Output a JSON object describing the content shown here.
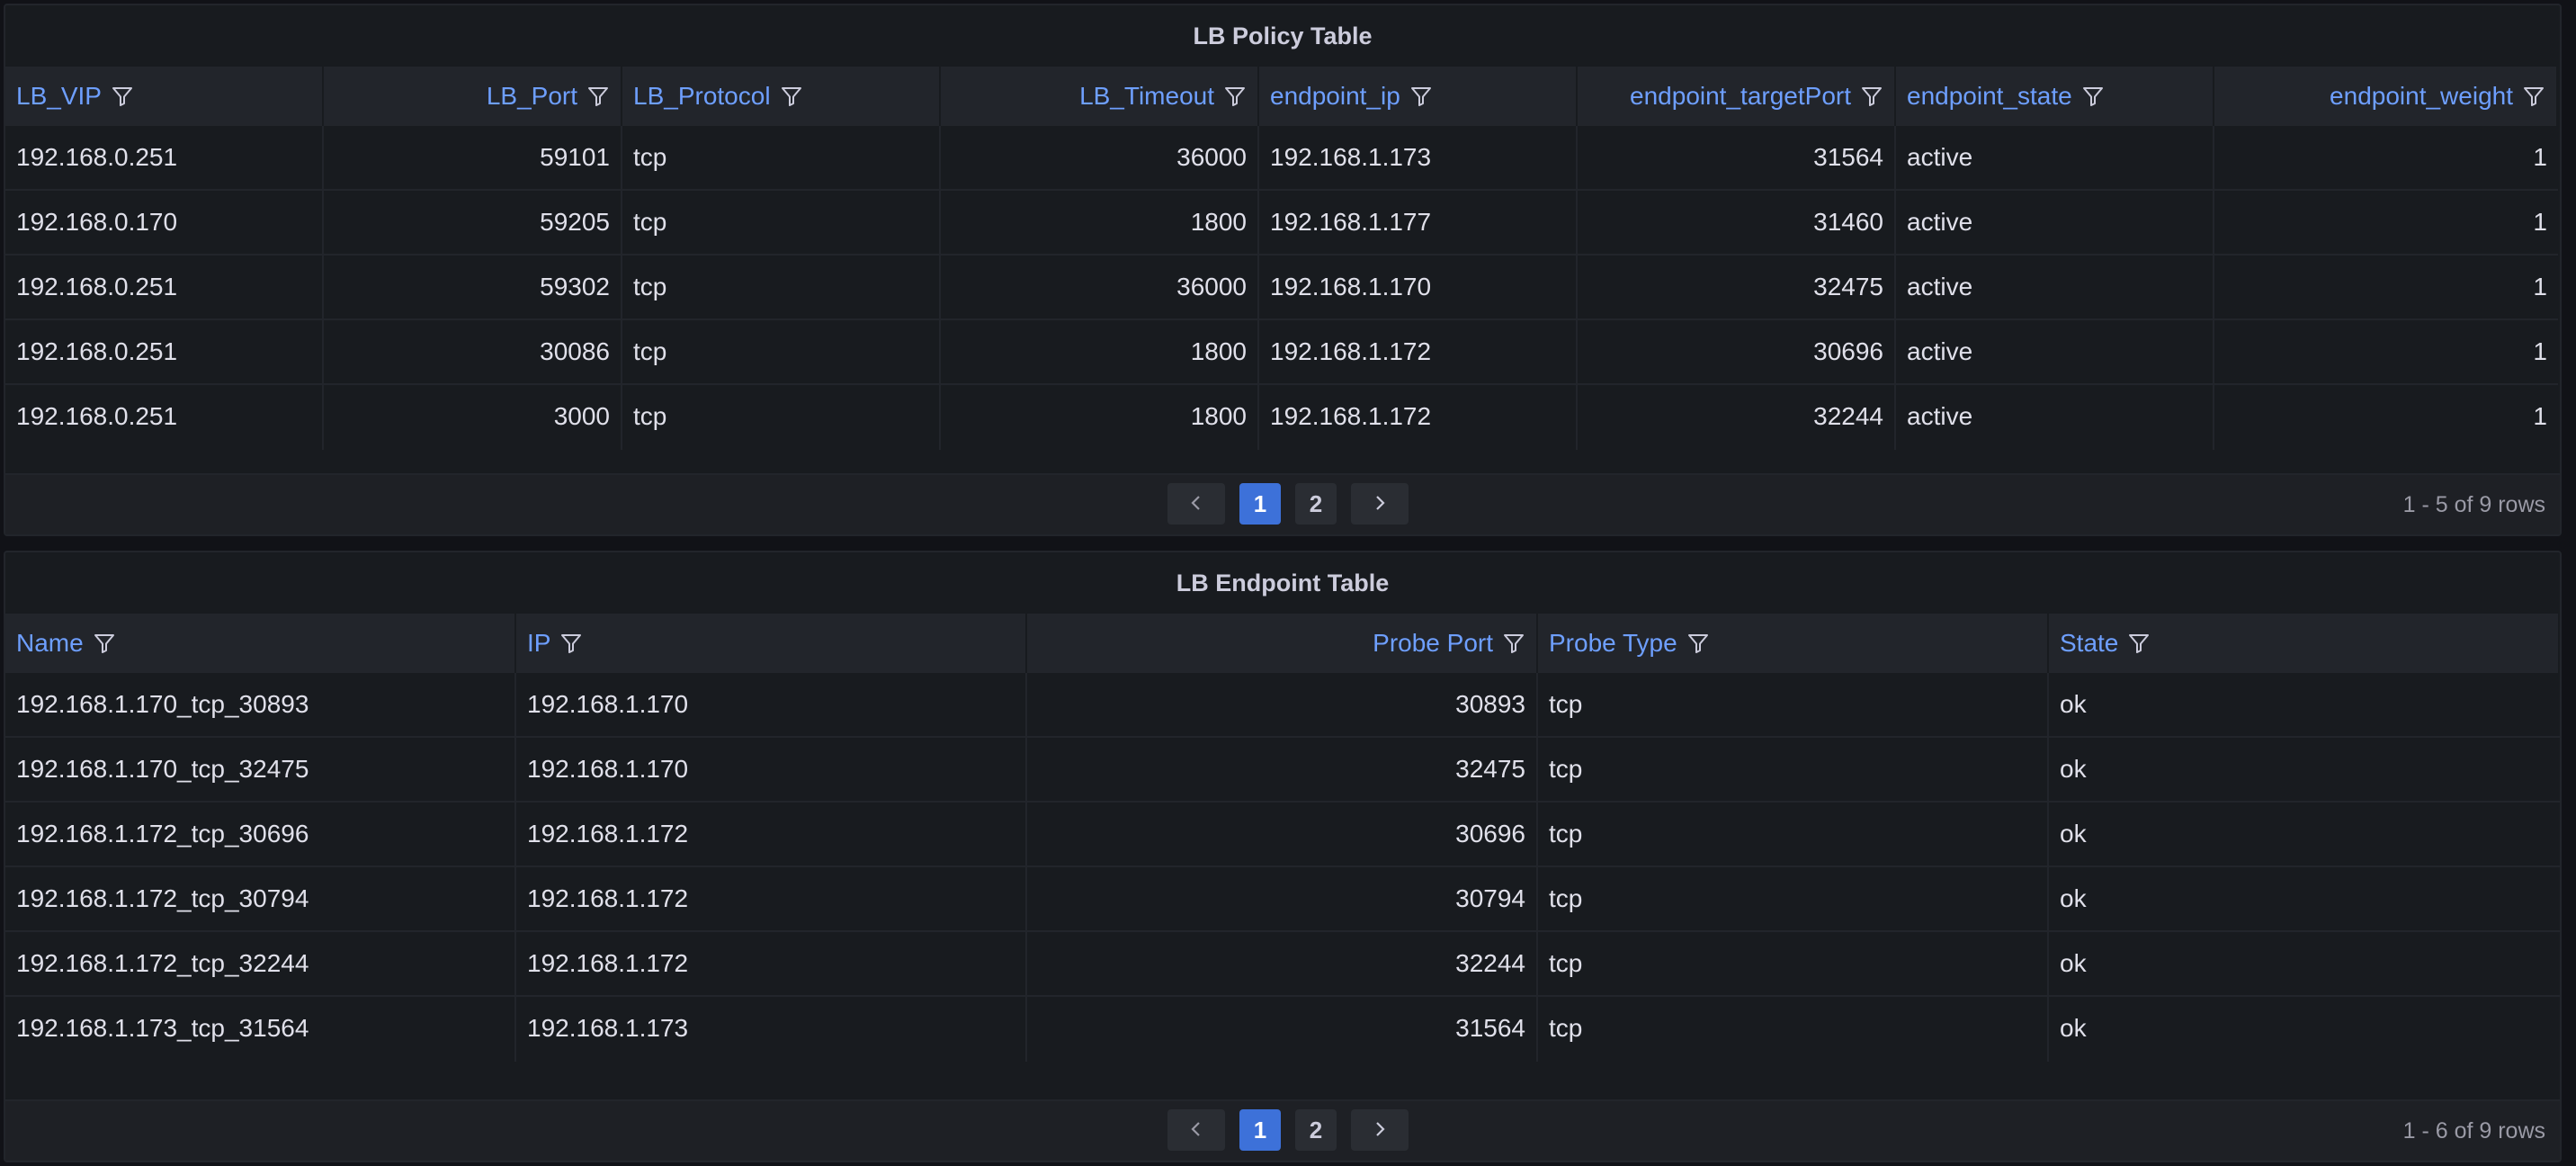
{
  "policy_table": {
    "title": "LB Policy Table",
    "columns": [
      {
        "label": "LB_VIP",
        "align": "left"
      },
      {
        "label": "LB_Port",
        "align": "right"
      },
      {
        "label": "LB_Protocol",
        "align": "left"
      },
      {
        "label": "LB_Timeout",
        "align": "right"
      },
      {
        "label": "endpoint_ip",
        "align": "left"
      },
      {
        "label": "endpoint_targetPort",
        "align": "right"
      },
      {
        "label": "endpoint_state",
        "align": "left"
      },
      {
        "label": "endpoint_weight",
        "align": "right"
      }
    ],
    "rows": [
      [
        "192.168.0.251",
        "59101",
        "tcp",
        "36000",
        "192.168.1.173",
        "31564",
        "active",
        "1"
      ],
      [
        "192.168.0.170",
        "59205",
        "tcp",
        "1800",
        "192.168.1.177",
        "31460",
        "active",
        "1"
      ],
      [
        "192.168.0.251",
        "59302",
        "tcp",
        "36000",
        "192.168.1.170",
        "32475",
        "active",
        "1"
      ],
      [
        "192.168.0.251",
        "30086",
        "tcp",
        "1800",
        "192.168.1.172",
        "30696",
        "active",
        "1"
      ],
      [
        "192.168.0.251",
        "3000",
        "tcp",
        "1800",
        "192.168.1.172",
        "32244",
        "active",
        "1"
      ]
    ],
    "pagination": {
      "prev_icon": "chevron-left-icon",
      "pages": [
        "1",
        "2"
      ],
      "current_page": "1",
      "next_icon": "chevron-right-icon",
      "row_count": "1 - 5 of 9 rows"
    }
  },
  "endpoint_table": {
    "title": "LB Endpoint Table",
    "columns": [
      {
        "label": "Name",
        "align": "left"
      },
      {
        "label": "IP",
        "align": "left"
      },
      {
        "label": "Probe Port",
        "align": "right"
      },
      {
        "label": "Probe Type",
        "align": "left"
      },
      {
        "label": "State",
        "align": "left"
      }
    ],
    "rows": [
      [
        "192.168.1.170_tcp_30893",
        "192.168.1.170",
        "30893",
        "tcp",
        "ok"
      ],
      [
        "192.168.1.170_tcp_32475",
        "192.168.1.170",
        "32475",
        "tcp",
        "ok"
      ],
      [
        "192.168.1.172_tcp_30696",
        "192.168.1.172",
        "30696",
        "tcp",
        "ok"
      ],
      [
        "192.168.1.172_tcp_30794",
        "192.168.1.172",
        "30794",
        "tcp",
        "ok"
      ],
      [
        "192.168.1.172_tcp_32244",
        "192.168.1.172",
        "32244",
        "tcp",
        "ok"
      ],
      [
        "192.168.1.173_tcp_31564",
        "192.168.1.173",
        "31564",
        "tcp",
        "ok"
      ]
    ],
    "pagination": {
      "prev_icon": "chevron-left-icon",
      "pages": [
        "1",
        "2"
      ],
      "current_page": "1",
      "next_icon": "chevron-right-icon",
      "row_count": "1 - 6 of 9 rows"
    }
  },
  "colors": {
    "background": "#111217",
    "panel": "#181b1f",
    "header_row": "#22252b",
    "header_text": "#6e9fff",
    "active_page": "#3d71d9"
  },
  "icons": {
    "column_filter": "filter-icon"
  }
}
